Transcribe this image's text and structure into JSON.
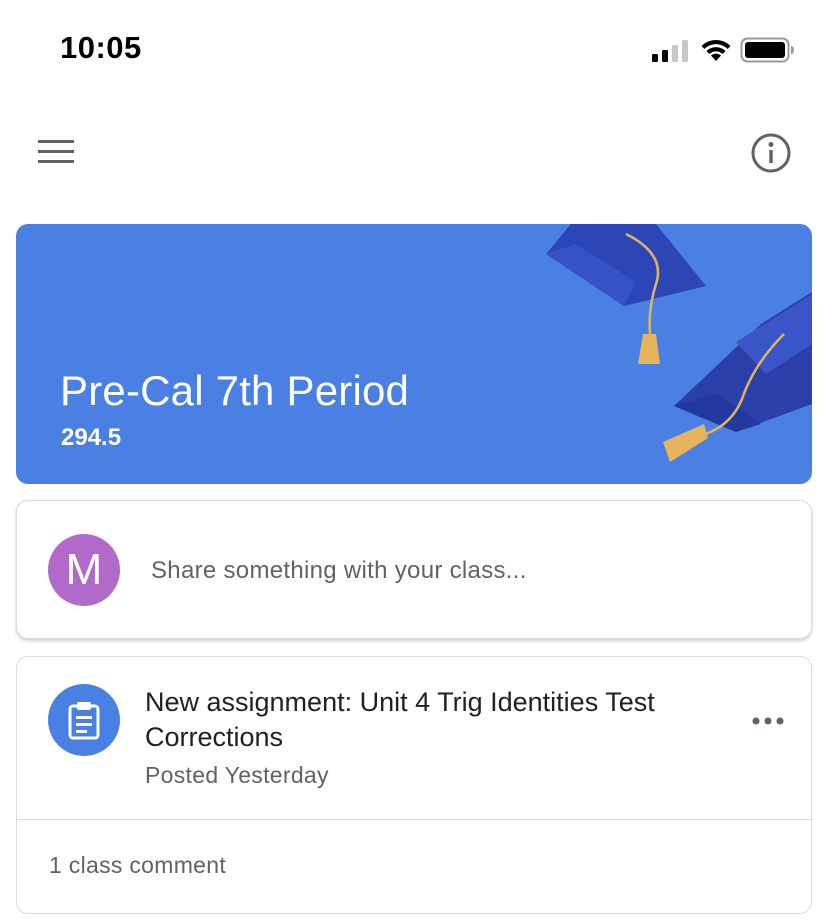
{
  "status_bar": {
    "time": "10:05",
    "icons": [
      "signal-icon",
      "wifi-icon",
      "battery-icon"
    ]
  },
  "app_bar": {
    "menu_icon": "hamburger-menu-icon",
    "info_icon": "info-icon"
  },
  "banner": {
    "title": "Pre-Cal 7th Period",
    "subtitle": "294.5",
    "background_color": "#4a7fe3",
    "decoration": "graduation-caps"
  },
  "share": {
    "avatar_letter": "M",
    "avatar_color": "#b16ac9",
    "placeholder": "Share something with your class..."
  },
  "post": {
    "icon": "assignment-icon",
    "title": "New assignment: Unit 4 Trig Identities Test Corrections",
    "meta": "Posted Yesterday",
    "more_icon": "more-horizontal-icon",
    "comments": "1 class comment"
  }
}
